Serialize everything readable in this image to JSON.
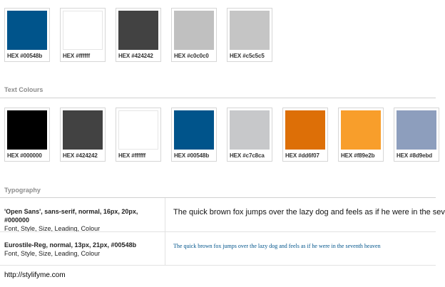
{
  "background_swatches": [
    {
      "label": "HEX #00548b",
      "color": "#00548b"
    },
    {
      "label": "HEX #ffffff",
      "color": "#ffffff"
    },
    {
      "label": "HEX #424242",
      "color": "#424242"
    },
    {
      "label": "HEX #c0c0c0",
      "color": "#c0c0c0"
    },
    {
      "label": "HEX #c5c5c5",
      "color": "#c5c5c5"
    }
  ],
  "text_colours": {
    "title": "Text Colours",
    "swatches": [
      {
        "label": "HEX #000000",
        "color": "#000000"
      },
      {
        "label": "HEX #424242",
        "color": "#424242"
      },
      {
        "label": "HEX #ffffff",
        "color": "#ffffff"
      },
      {
        "label": "HEX #00548b",
        "color": "#00548b"
      },
      {
        "label": "HEX #c7c8ca",
        "color": "#c7c8ca"
      },
      {
        "label": "HEX #dd6f07",
        "color": "#dd6f07"
      },
      {
        "label": "HEX #f89e2b",
        "color": "#f89e2b"
      },
      {
        "label": "HEX #8d9ebd",
        "color": "#8d9ebd"
      }
    ]
  },
  "typography": {
    "title": "Typography",
    "rows": [
      {
        "spec_bold": "'Open Sans', sans-serif, normal, 16px, 20px, #000000",
        "spec_note": "Font, Style, Size, Leading, Colour",
        "sample": "The quick brown fox jumps over the lazy dog and feels as if he were in the seven"
      },
      {
        "spec_bold": "Eurostile-Reg, normal, 13px, 21px, #00548b",
        "spec_note": "Font, Style, Size, Leading, Colour",
        "sample": "The quick brown fox jumps over the lazy dog and feels as if he were in the seventh heaven"
      }
    ]
  },
  "footer": {
    "url": "http://stylifyme.com"
  }
}
